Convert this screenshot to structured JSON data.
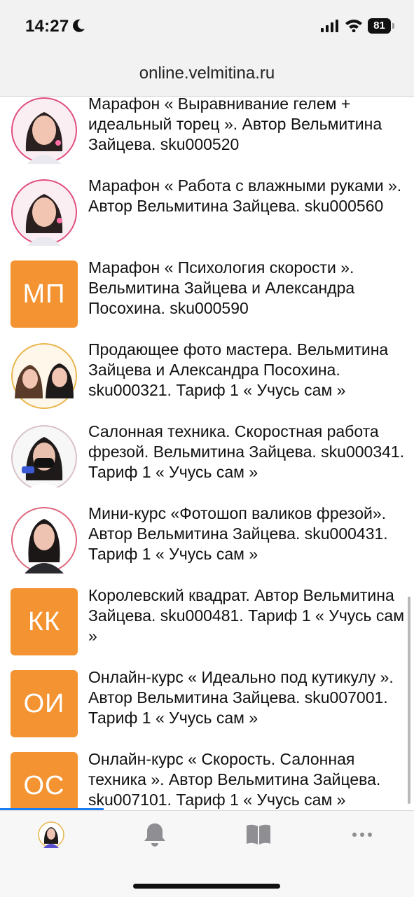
{
  "status_bar": {
    "time": "14:27",
    "battery": "81",
    "icons": [
      "moon-icon",
      "signal-icon",
      "wifi-icon",
      "battery-icon"
    ]
  },
  "browser": {
    "url": "online.velmitina.ru"
  },
  "colors": {
    "initials_bg": "#f39332",
    "progress": "#1a7cf0"
  },
  "courses": [
    {
      "thumb_type": "avatar",
      "title": "Марафон « Выравнивание гелем + идеальный торец ». Автор Вельмитина Зайцева. sku000520"
    },
    {
      "thumb_type": "avatar",
      "title": "Марафон « Работа с влажными руками ». Автор Вельмитина Зайцева. sku000560"
    },
    {
      "thumb_type": "initials",
      "initials": "МП",
      "title": "Марафон « Психология скорости ». Вельмитина Зайцева и Александра Посохина. sku000590"
    },
    {
      "thumb_type": "avatar",
      "title": "Продающее фото мастера. Вельмитина Зайцева и Александра Посохина. sku000321. Тариф 1 « Учусь сам »"
    },
    {
      "thumb_type": "avatar",
      "title": "Салонная техника. Скоростная работа фрезой. Вельмитина Зайцева. sku000341. Тариф 1 « Учусь сам »"
    },
    {
      "thumb_type": "avatar",
      "title": "Мини-курс «Фотошоп валиков фрезой». Автор Вельмитина Зайцева. sku000431. Тариф 1 « Учусь сам »"
    },
    {
      "thumb_type": "initials",
      "initials": "КК",
      "title": "Королевский квадрат. Автор Вельмитина Зайцева. sku000481. Тариф 1 « Учусь сам »"
    },
    {
      "thumb_type": "initials",
      "initials": "ОИ",
      "title": "Онлайн-курс « Идеально под кутикулу ». Автор Вельмитина Зайцева. sku007001. Тариф 1 « Учусь сам »"
    },
    {
      "thumb_type": "initials",
      "initials": "ОС",
      "title": "Онлайн-курс « Скорость. Салонная техника ». Автор Вельмитина Зайцева. sku007101. Тариф 1 « Учусь сам »"
    }
  ],
  "tab_bar": {
    "tabs": [
      "profile-avatar",
      "bell-icon",
      "book-icon",
      "more-icon"
    ]
  }
}
